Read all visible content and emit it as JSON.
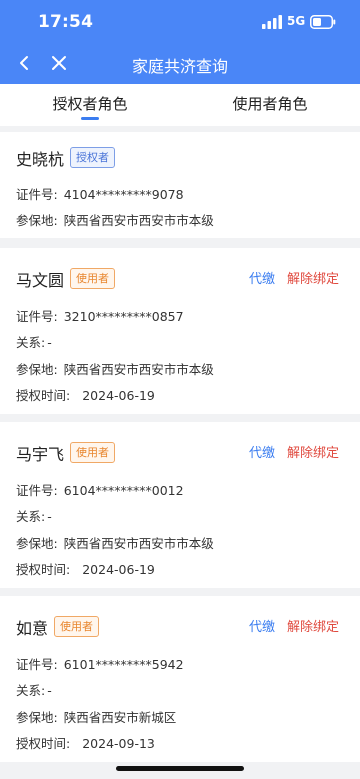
{
  "status": {
    "time": "17:54",
    "network": "5G"
  },
  "nav": {
    "title": "家庭共济查询"
  },
  "tabs": [
    {
      "label": "授权者角色"
    },
    {
      "label": "使用者角色"
    }
  ],
  "colors": {
    "header": "#4a86f7",
    "accent": "#3b7df0",
    "danger": "#e04a3f",
    "user_badge": "#e8862e"
  },
  "authorizer": {
    "name": "史晓杭",
    "badge": "授权者",
    "id_label": "证件号:",
    "id_value": "4104*********9078",
    "place_label": "参保地:",
    "place_value": "陕西省西安市西安市市本级"
  },
  "users": [
    {
      "name": "马文圆",
      "badge": "使用者",
      "pay": "代缴",
      "unbind": "解除绑定",
      "id_label": "证件号:",
      "id_value": "3210*********0857",
      "rel_label": "关系:",
      "rel_value": "-",
      "place_label": "参保地:",
      "place_value": "陕西省西安市西安市市本级",
      "time_label": "授权时间:",
      "time_value": "2024-06-19"
    },
    {
      "name": "马宇飞",
      "badge": "使用者",
      "pay": "代缴",
      "unbind": "解除绑定",
      "id_label": "证件号:",
      "id_value": "6104*********0012",
      "rel_label": "关系:",
      "rel_value": "-",
      "place_label": "参保地:",
      "place_value": "陕西省西安市西安市市本级",
      "time_label": "授权时间:",
      "time_value": "2024-06-19"
    },
    {
      "name": "如意",
      "badge": "使用者",
      "pay": "代缴",
      "unbind": "解除绑定",
      "id_label": "证件号:",
      "id_value": "6101*********5942",
      "rel_label": "关系:",
      "rel_value": "-",
      "place_label": "参保地:",
      "place_value": "陕西省西安市新城区",
      "time_label": "授权时间:",
      "time_value": "2024-09-13"
    }
  ]
}
